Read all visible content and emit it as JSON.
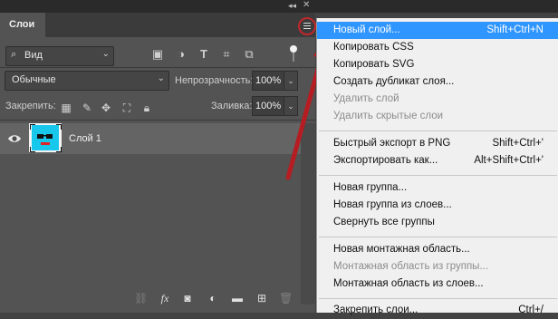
{
  "panel": {
    "tab": "Слои",
    "filter_kind": "Вид",
    "blend_mode": "Обычные",
    "opacity_label": "Непрозрачность:",
    "opacity_value": "100%",
    "lock_label": "Закрепить:",
    "fill_label": "Заливка:",
    "fill_value": "100%"
  },
  "layers": [
    {
      "name": "Слой 1",
      "thumbnail_color": "#18c7ec"
    }
  ],
  "menu": {
    "items": [
      {
        "label": "Новый слой...",
        "shortcut": "Shift+Ctrl+N",
        "highlighted": true
      },
      {
        "label": "Копировать CSS",
        "shortcut": ""
      },
      {
        "label": "Копировать SVG",
        "shortcut": ""
      },
      {
        "label": "Создать дубликат слоя...",
        "shortcut": ""
      },
      {
        "label": "Удалить слой",
        "shortcut": "",
        "disabled": true
      },
      {
        "label": "Удалить скрытые слои",
        "shortcut": "",
        "disabled": true
      },
      {
        "label": "Быстрый экспорт в PNG",
        "shortcut": "Shift+Ctrl+'"
      },
      {
        "label": "Экспортировать как...",
        "shortcut": "Alt+Shift+Ctrl+'"
      },
      {
        "label": "Новая группа...",
        "shortcut": ""
      },
      {
        "label": "Новая группа из слоев...",
        "shortcut": ""
      },
      {
        "label": "Свернуть все группы",
        "shortcut": ""
      },
      {
        "label": "Новая монтажная область...",
        "shortcut": ""
      },
      {
        "label": "Монтажная область из группы...",
        "shortcut": "",
        "disabled": true
      },
      {
        "label": "Монтажная область из слоев...",
        "shortcut": ""
      },
      {
        "label": "Закрепить слои...",
        "shortcut": "Ctrl+/"
      }
    ]
  },
  "colors": {
    "accent": "#2f95ff",
    "annotation": "#c1272d"
  }
}
